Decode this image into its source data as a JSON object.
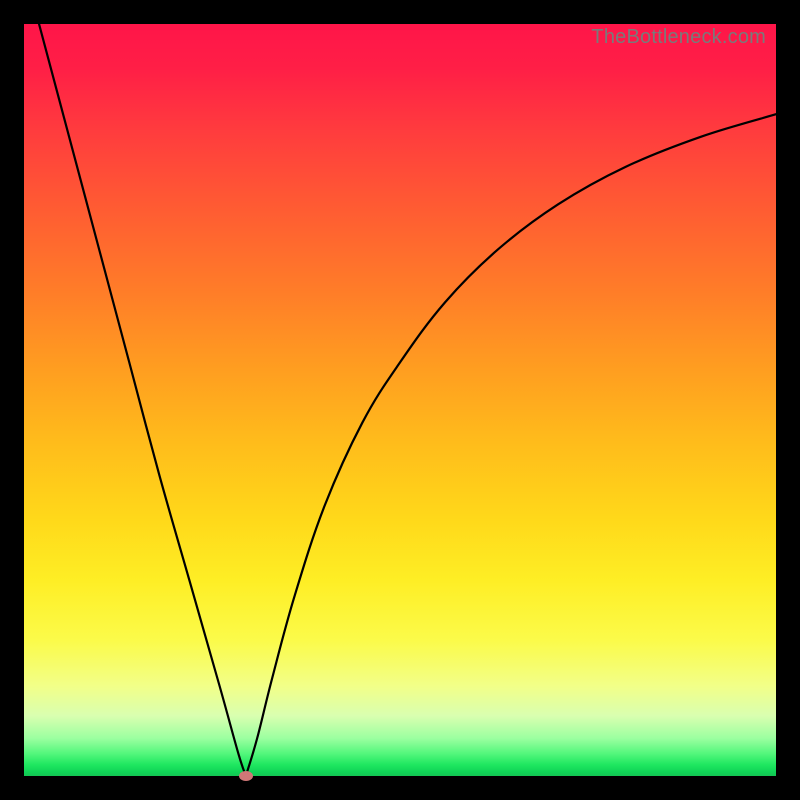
{
  "attribution": "TheBottleneck.com",
  "chart_data": {
    "type": "line",
    "title": "",
    "xlabel": "",
    "ylabel": "",
    "xlim": [
      0,
      100
    ],
    "ylim": [
      0,
      100
    ],
    "grid": false,
    "legend": false,
    "series": [
      {
        "name": "left-branch",
        "x": [
          2,
          6,
          10,
          14,
          18,
          22,
          26,
          28.5,
          29.5
        ],
        "y": [
          100,
          85,
          70,
          55,
          40,
          26,
          12,
          3,
          0
        ]
      },
      {
        "name": "right-branch",
        "x": [
          29.5,
          31,
          33,
          36,
          40,
          45,
          50,
          56,
          63,
          71,
          80,
          90,
          100
        ],
        "y": [
          0,
          5,
          13,
          24,
          36,
          47,
          55,
          63,
          70,
          76,
          81,
          85,
          88
        ]
      }
    ],
    "marker": {
      "x": 29.5,
      "y": 0,
      "color": "#cf7777"
    },
    "background_gradient_stops": [
      {
        "pos": 0,
        "color": "#ff1549"
      },
      {
        "pos": 36,
        "color": "#ff7e28"
      },
      {
        "pos": 66,
        "color": "#ffd91a"
      },
      {
        "pos": 88,
        "color": "#f2ff88"
      },
      {
        "pos": 98,
        "color": "#1fe760"
      },
      {
        "pos": 100,
        "color": "#14c554"
      }
    ]
  }
}
